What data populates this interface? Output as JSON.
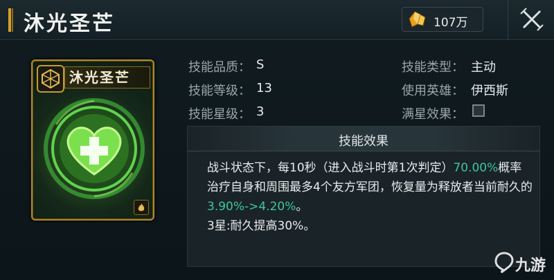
{
  "header": {
    "title": "沐光圣芒",
    "currency_amount": "107万",
    "currency_icon": "gold-crystal-icon",
    "close_icon": "close-icon"
  },
  "card": {
    "name": "沐光圣芒",
    "badge_icon": "hexagon-emblem-icon",
    "art_icon": "healing-heart-cross-icon",
    "corner_icon": "flame-rank-icon"
  },
  "info": {
    "quality_label": "技能品质：",
    "quality_value": "S",
    "level_label": "技能等级：",
    "level_value": "13",
    "star_label": "技能星级：",
    "star_value": "3",
    "type_label": "技能类型：",
    "type_value": "主动",
    "hero_label": "使用英雄：",
    "hero_value": "伊西斯",
    "fullstar_label": "满星效果：",
    "fullstar_checked": false
  },
  "effect": {
    "title": "技能效果",
    "text_part1": "战斗状态下，每10秒（进入战斗时第1次判定）",
    "text_hl1": "70.00%",
    "text_part2": "概率治疗自身和周围最多4个友方军团，恢复量为释放者当前耐久的",
    "text_hl2": "3.90%->4.20%",
    "text_part3": "。",
    "star_line": "3星:耐久提高30%。"
  },
  "colors": {
    "accent_gold": "#d8a12a",
    "highlight_green": "#3ec79a"
  }
}
